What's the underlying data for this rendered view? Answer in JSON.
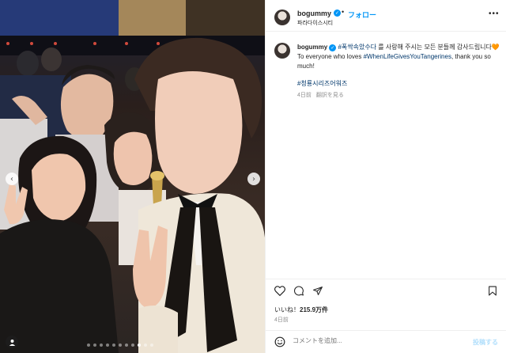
{
  "post": {
    "username": "bogummy",
    "verified_mark": "✓",
    "separator": "•",
    "follow_label": "フォロー",
    "location": "파라다이스시티",
    "more_label": "•••",
    "caption": {
      "hashtag_top": "#폭싹속았수다",
      "text_korean": " 를 사랑해 주시는 모든 분들께 감사드립니다🧡",
      "text_english_pre": "To everyone who loves ",
      "hashtag_en": "#WhenLifeGivesYouTangerines",
      "text_english_post": ", thank you so much!",
      "hashtag_award": "#청룡시리즈어워즈",
      "age": "4日前",
      "translate_label": "翻訳を見る"
    },
    "likes_prefix": "いいね！",
    "likes_count": "215.9万件",
    "date": "4日前",
    "comment_placeholder": "コメントを追加...",
    "post_button": "投稿する",
    "icons": [
      "heart-icon",
      "comment-icon",
      "share-icon",
      "bookmark-icon",
      "emoji-icon",
      "tag-person-icon",
      "chevron-left-icon",
      "chevron-right-icon"
    ],
    "carousel": {
      "count": 11,
      "active_index": 8
    }
  },
  "colors": {
    "link": "#00376b",
    "accent": "#0095f6",
    "muted": "#8e8e8e"
  }
}
